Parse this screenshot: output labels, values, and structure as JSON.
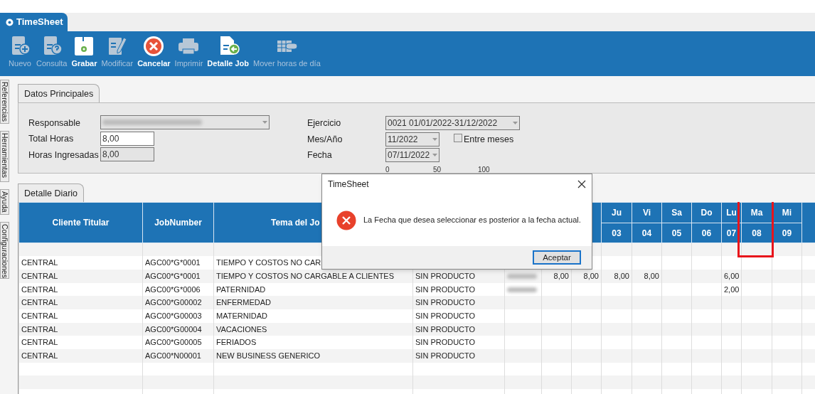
{
  "app_tab": {
    "label": "TimeSheet",
    "selected": true
  },
  "toolbar": [
    {
      "label": "Nuevo",
      "kind": "new",
      "disabled": true
    },
    {
      "label": "Consulta",
      "kind": "query",
      "disabled": true
    },
    {
      "label": "Grabar",
      "kind": "save",
      "disabled": false
    },
    {
      "label": "Modificar",
      "kind": "edit",
      "disabled": true
    },
    {
      "label": "Cancelar",
      "kind": "cancel",
      "disabled": false
    },
    {
      "label": "Imprimir",
      "kind": "print",
      "disabled": true
    },
    {
      "label": "Detalle Job",
      "kind": "detail",
      "disabled": false
    },
    {
      "label": "Mover horas de día",
      "kind": "excel",
      "disabled": true
    }
  ],
  "side_tabs": [
    "Referencias",
    "Herramientas",
    "Ayuda",
    "Configuraciones"
  ],
  "main_section": {
    "tab": "Datos Principales",
    "fields": {
      "responsable": {
        "label": "Responsable",
        "redacted": true
      },
      "total_horas": {
        "label": "Total Horas",
        "value": "8,00"
      },
      "horas_ingresadas": {
        "label": "Horas Ingresadas",
        "value": "8,00"
      },
      "ejercicio": {
        "label": "Ejercicio",
        "value": "0021 01/01/2022-31/12/2022"
      },
      "mes_ano": {
        "label": "Mes/Año",
        "value": "11/2022"
      },
      "entre_meses": {
        "label": "Entre meses",
        "checked": false
      },
      "fecha": {
        "label": "Fecha",
        "value": "07/11/2022"
      },
      "scale": [
        "0",
        "50",
        "100"
      ]
    }
  },
  "detail_section": {
    "tab": "Detalle Diario",
    "columns": [
      {
        "kind": "text",
        "label": "Cliente Titular"
      },
      {
        "kind": "text",
        "label": "JobNumber"
      },
      {
        "kind": "text",
        "label": "Tema del Jo"
      },
      {
        "kind": "blank"
      },
      {
        "kind": "blank"
      },
      {
        "kind": "blank"
      },
      {
        "kind": "blank"
      },
      {
        "kind": "day",
        "day": "Ju",
        "date": "03",
        "highlighted": false
      },
      {
        "kind": "day",
        "day": "Vi",
        "date": "04",
        "highlighted": false
      },
      {
        "kind": "day",
        "day": "Sa",
        "date": "05",
        "highlighted": false
      },
      {
        "kind": "day",
        "day": "Do",
        "date": "06",
        "highlighted": false
      },
      {
        "kind": "day",
        "day": "Lu",
        "date": "07",
        "highlighted": false
      },
      {
        "kind": "day",
        "day": "Ma",
        "date": "08",
        "highlighted": true
      },
      {
        "kind": "day",
        "day": "Mi",
        "date": "09",
        "highlighted": false
      },
      {
        "kind": "blank"
      }
    ],
    "rows": [
      {
        "cliente": "CENTRAL",
        "job": "AGC00*G*0001",
        "tema": "TIEMPO Y COSTOS NO CAR",
        "redacted": false
      },
      {
        "cliente": "CENTRAL",
        "job": "AGC00*G*0001",
        "tema": "TIEMPO Y COSTOS NO CARGABLE A CLIENTES",
        "producto": "SIN PRODUCTO",
        "redacted": true,
        "hours": {
          "5": "8,00",
          "6": "8,00",
          "7": "8,00",
          "8": "8,00",
          "11": "6,00"
        }
      },
      {
        "cliente": "CENTRAL",
        "job": "AGC00*G*0006",
        "tema": "PATERNIDAD",
        "producto": "SIN PRODUCTO",
        "redacted": true,
        "hours": {
          "11": "2,00"
        }
      },
      {
        "cliente": "CENTRAL",
        "job": "AGC00*G00002",
        "tema": "ENFERMEDAD",
        "producto": "SIN PRODUCTO",
        "redacted": false
      },
      {
        "cliente": "CENTRAL",
        "job": "AGC00*G00003",
        "tema": "MATERNIDAD",
        "producto": "SIN PRODUCTO",
        "redacted": false
      },
      {
        "cliente": "CENTRAL",
        "job": "AGC00*G00004",
        "tema": "VACACIONES",
        "producto": "SIN PRODUCTO",
        "redacted": false
      },
      {
        "cliente": "CENTRAL",
        "job": "AGC00*G00005",
        "tema": "FERIADOS",
        "producto": "SIN PRODUCTO",
        "redacted": false
      },
      {
        "cliente": "CENTRAL",
        "job": "AGC00*N00001",
        "tema": "NEW BUSINESS GENERICO",
        "producto": "SIN PRODUCTO",
        "redacted": false
      }
    ]
  },
  "dialog": {
    "title": "TimeSheet",
    "message": "La Fecha que desea seleccionar es posterior a la fecha actual.",
    "button": "Aceptar"
  }
}
